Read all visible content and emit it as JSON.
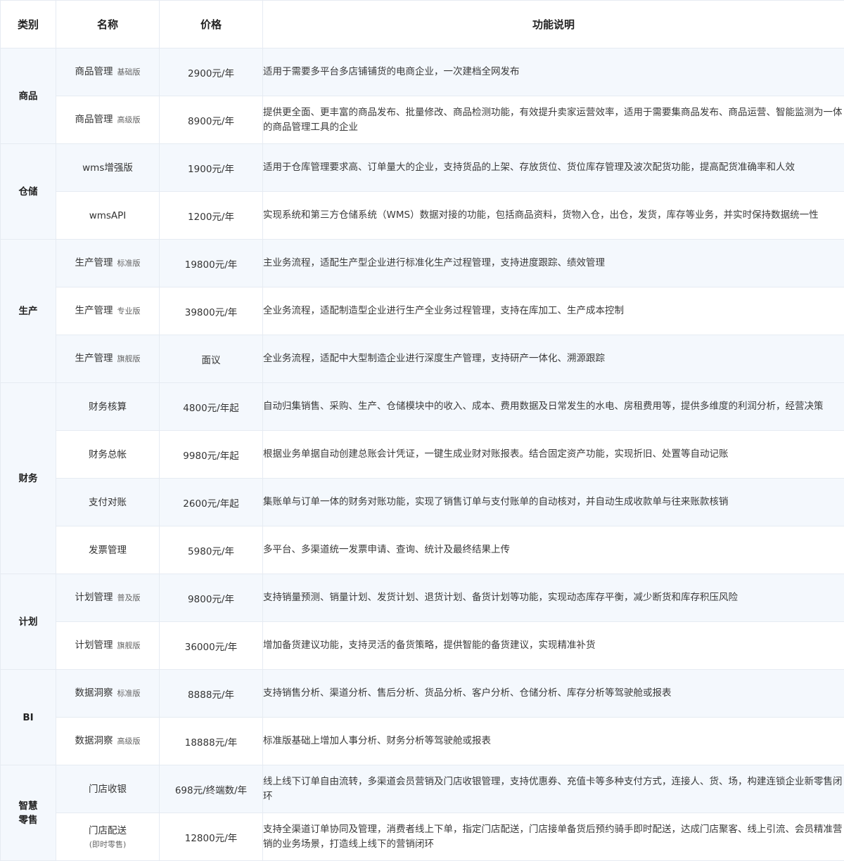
{
  "headers": {
    "category": "类别",
    "name": "名称",
    "price": "价格",
    "description": "功能说明"
  },
  "categories": [
    {
      "label": "商品",
      "rows": [
        {
          "name": "商品管理",
          "edition": "基础版",
          "price": "2900元/年",
          "desc": "适用于需要多平台多店铺铺货的电商企业，一次建档全网发布"
        },
        {
          "name": "商品管理",
          "edition": "高级版",
          "price": "8900元/年",
          "desc": "提供更全面、更丰富的商品发布、批量修改、商品检测功能，有效提升卖家运营效率，适用于需要集商品发布、商品运营、智能监测为一体的商品管理工具的企业"
        }
      ]
    },
    {
      "label": "仓储",
      "rows": [
        {
          "name": "wms增强版",
          "price": "1900元/年",
          "desc": "适用于仓库管理要求高、订单量大的企业，支持货品的上架、存放货位、货位库存管理及波次配货功能，提高配货准确率和人效"
        },
        {
          "name": "wmsAPI",
          "price": "1200元/年",
          "desc": "实现系统和第三方仓储系统（WMS）数据对接的功能，包括商品资料，货物入仓，出仓，发货，库存等业务，并实时保持数据统一性"
        }
      ]
    },
    {
      "label": "生产",
      "rows": [
        {
          "name": "生产管理",
          "edition": "标准版",
          "price": "19800元/年",
          "desc": "主业务流程，适配生产型企业进行标准化生产过程管理，支持进度跟踪、绩效管理"
        },
        {
          "name": "生产管理",
          "edition": "专业版",
          "price": "39800元/年",
          "desc": "全业务流程，适配制造型企业进行生产全业务过程管理，支持在库加工、生产成本控制"
        },
        {
          "name": "生产管理",
          "edition": "旗舰版",
          "price": "面议",
          "desc": "全业务流程，适配中大型制造企业进行深度生产管理，支持研产一体化、溯源跟踪"
        }
      ]
    },
    {
      "label": "财务",
      "rows": [
        {
          "name": "财务核算",
          "price": "4800元/年起",
          "desc": "自动归集销售、采购、生产、仓储模块中的收入、成本、费用数据及日常发生的水电、房租费用等，提供多维度的利润分析，经营决策"
        },
        {
          "name": "财务总帐",
          "price": "9980元/年起",
          "desc": "根据业务单据自动创建总账会计凭证，一键生成业财对账报表。结合固定资产功能，实现折旧、处置等自动记账"
        },
        {
          "name": "支付对账",
          "price": "2600元/年起",
          "desc": "集账单与订单一体的财务对账功能，实现了销售订单与支付账单的自动核对，并自动生成收款单与往来账款核销"
        },
        {
          "name": "发票管理",
          "price": "5980元/年",
          "desc": "多平台、多渠道统一发票申请、查询、统计及最终结果上传"
        }
      ]
    },
    {
      "label": "计划",
      "rows": [
        {
          "name": "计划管理",
          "edition": "普及版",
          "price": "9800元/年",
          "desc": "支持销量预测、销量计划、发货计划、退货计划、备货计划等功能，实现动态库存平衡，减少断货和库存积压风险"
        },
        {
          "name": "计划管理",
          "edition": "旗舰版",
          "price": "36000元/年",
          "desc": "增加备货建议功能，支持灵活的备货策略，提供智能的备货建议，实现精准补货"
        }
      ]
    },
    {
      "label": "BI",
      "rows": [
        {
          "name": "数据洞察",
          "edition": "标准版",
          "price": "8888元/年",
          "desc": "支持销售分析、渠道分析、售后分析、货品分析、客户分析、仓储分析、库存分析等驾驶舱或报表"
        },
        {
          "name": "数据洞察",
          "edition": "高级版",
          "price": "18888元/年",
          "desc": "标准版基础上增加人事分析、财务分析等驾驶舱或报表"
        }
      ]
    },
    {
      "label": "智慧零售",
      "label_lines": [
        "智慧",
        "零售"
      ],
      "rows": [
        {
          "name": "门店收银",
          "price": "698元/终端数/年",
          "desc": "线上线下订单自由流转，多渠道会员营销及门店收银管理，支持优惠券、充值卡等多种支付方式，连接人、货、场，构建连锁企业新零售闭环"
        },
        {
          "name": "门店配送",
          "note": "(即时零售)",
          "price": "12800元/年",
          "desc": "支持全渠道订单协同及管理，消费者线上下单，指定门店配送，门店接单备货后预约骑手即时配送，达成门店聚客、线上引流、会员精准营销的业务场景，打造线上线下的营销闭环"
        }
      ]
    }
  ]
}
